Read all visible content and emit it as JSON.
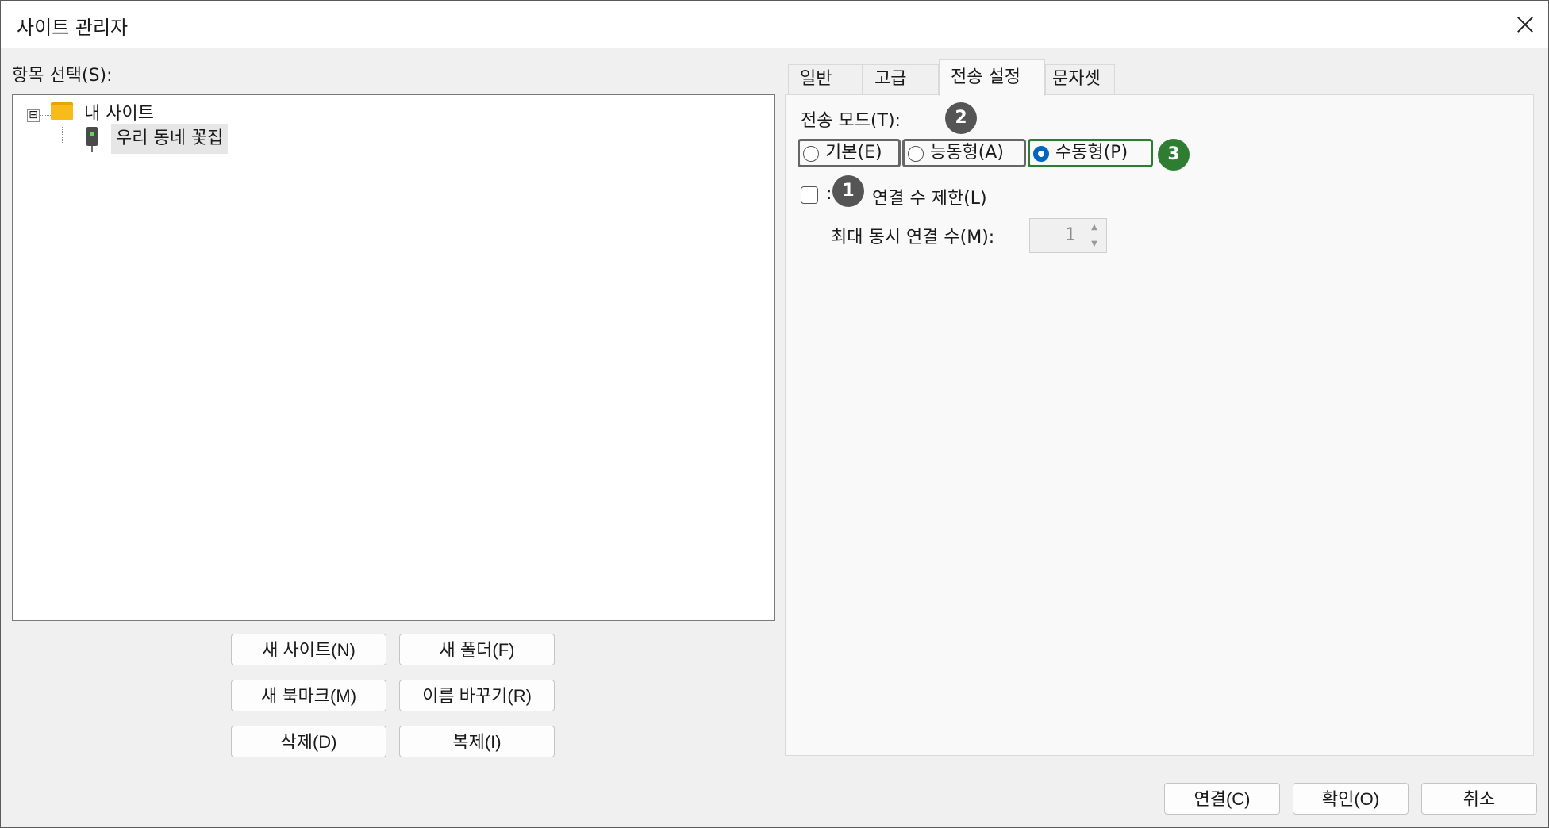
{
  "window": {
    "title": "사이트 관리자"
  },
  "left": {
    "label": "항목 선택(S):",
    "tree": {
      "root": {
        "expander": "⊟",
        "label": "내 사이트"
      },
      "child": {
        "label": "우리 동네 꽃집"
      }
    },
    "buttons": {
      "new_site": "새 사이트(N)",
      "new_folder": "새 폴더(F)",
      "new_bookmark": "새 북마크(M)",
      "rename": "이름 바꾸기(R)",
      "delete": "삭제(D)",
      "duplicate": "복제(I)"
    }
  },
  "tabs": [
    {
      "label": "일반",
      "active": false
    },
    {
      "label": "고급",
      "active": false
    },
    {
      "label": "전송 설정",
      "active": true
    },
    {
      "label": "문자셋",
      "active": false
    }
  ],
  "transfer": {
    "mode_label": "전송 모드(T):",
    "modes": [
      {
        "label": "기본(E)",
        "checked": false
      },
      {
        "label": "능동형(A)",
        "checked": false
      },
      {
        "label": "수동형(P)",
        "checked": true
      }
    ],
    "limit_label_fragment": ":",
    "limit_label": "연결 수 제한(L)",
    "limit_checked": false,
    "max_label": "최대 동시 연결 수(M):",
    "max_value": "1"
  },
  "annotations": [
    {
      "number": "1",
      "color": "#555555"
    },
    {
      "number": "2",
      "color": "#555555"
    },
    {
      "number": "3",
      "color": "#2e7d32"
    }
  ],
  "footer": {
    "connect": "연결(C)",
    "ok": "확인(O)",
    "cancel": "취소"
  }
}
